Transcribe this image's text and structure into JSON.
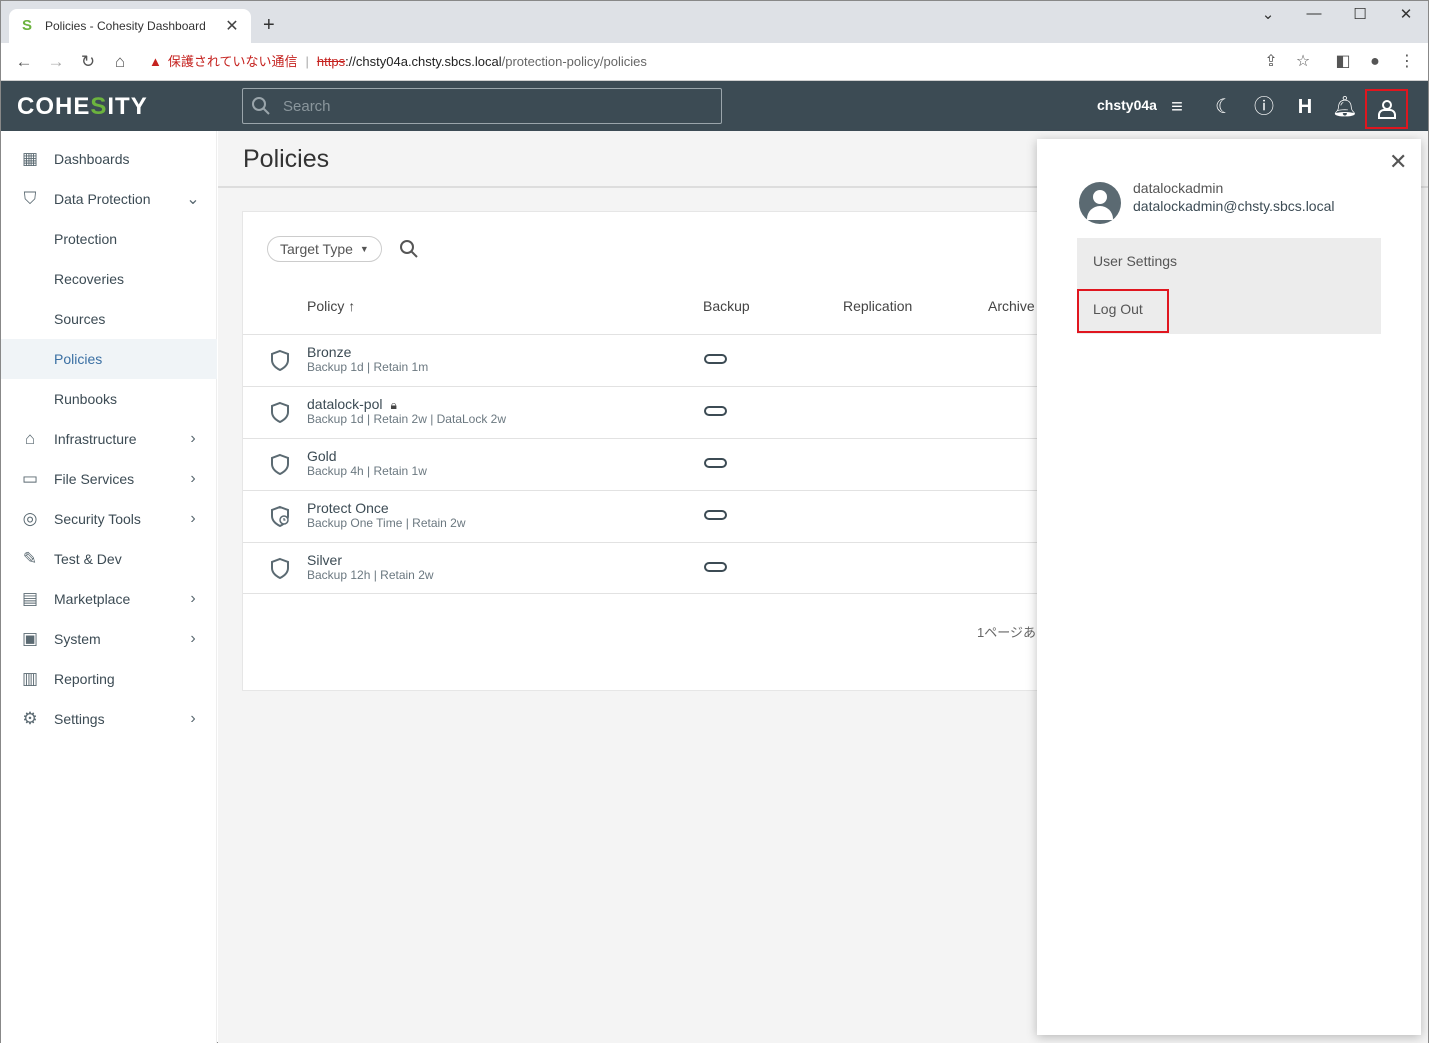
{
  "browser": {
    "tab_title": "Policies - Cohesity Dashboard",
    "tab_favicon": "S",
    "new_tab": "+",
    "not_secure": "保護されていない通信",
    "url_scheme": "https",
    "url_host": "://chsty04a.chsty.sbcs.local",
    "url_path": "/protection-policy/policies"
  },
  "header": {
    "logo_pre": "COHE",
    "logo_s": "S",
    "logo_post": "ITY",
    "search_placeholder": "Search",
    "cluster": "chsty04a",
    "health_letter": "H"
  },
  "sidebar": {
    "items": [
      {
        "label": "Dashboards",
        "icon": "dashboard-icon"
      },
      {
        "label": "Data Protection",
        "icon": "shield-check-icon",
        "expanded": true
      },
      {
        "label": "Protection"
      },
      {
        "label": "Recoveries"
      },
      {
        "label": "Sources"
      },
      {
        "label": "Policies",
        "active": true
      },
      {
        "label": "Runbooks"
      },
      {
        "label": "Infrastructure",
        "icon": "infrastructure-icon"
      },
      {
        "label": "File Services",
        "icon": "folder-icon"
      },
      {
        "label": "Security Tools",
        "icon": "fingerprint-icon"
      },
      {
        "label": "Test & Dev",
        "icon": "wrench-icon"
      },
      {
        "label": "Marketplace",
        "icon": "store-icon"
      },
      {
        "label": "System",
        "icon": "system-icon"
      },
      {
        "label": "Reporting",
        "icon": "chart-icon"
      },
      {
        "label": "Settings",
        "icon": "gear-icon"
      }
    ]
  },
  "main": {
    "title": "Policies",
    "filter_label": "Target Type",
    "columns": {
      "policy": "Policy",
      "sort_arrow": "↑",
      "backup": "Backup",
      "replication": "Replication",
      "archive": "Archive"
    },
    "rows": [
      {
        "name": "Bronze",
        "desc": "Backup 1d  |  Retain 1m",
        "locked": false
      },
      {
        "name": "datalock-pol",
        "desc": "Backup 1d  |  Retain 2w  |  DataLock 2w",
        "locked": true
      },
      {
        "name": "Gold",
        "desc": "Backup 4h  |  Retain 1w",
        "locked": false
      },
      {
        "name": "Protect Once",
        "desc": "Backup One Time  |  Retain 2w",
        "locked": false
      },
      {
        "name": "Silver",
        "desc": "Backup 12h  |  Retain 2w",
        "locked": false
      }
    ],
    "pager_text": "1ページあ"
  },
  "user_menu": {
    "username": "datalockadmin",
    "email": "datalockadmin@chsty.sbcs.local",
    "user_settings": "User Settings",
    "log_out": "Log Out"
  },
  "colors": {
    "header_bg": "#3c4b54",
    "brand_green": "#6cb33e",
    "highlight_red": "#e0161f",
    "active_nav": "#3a6fa3"
  }
}
